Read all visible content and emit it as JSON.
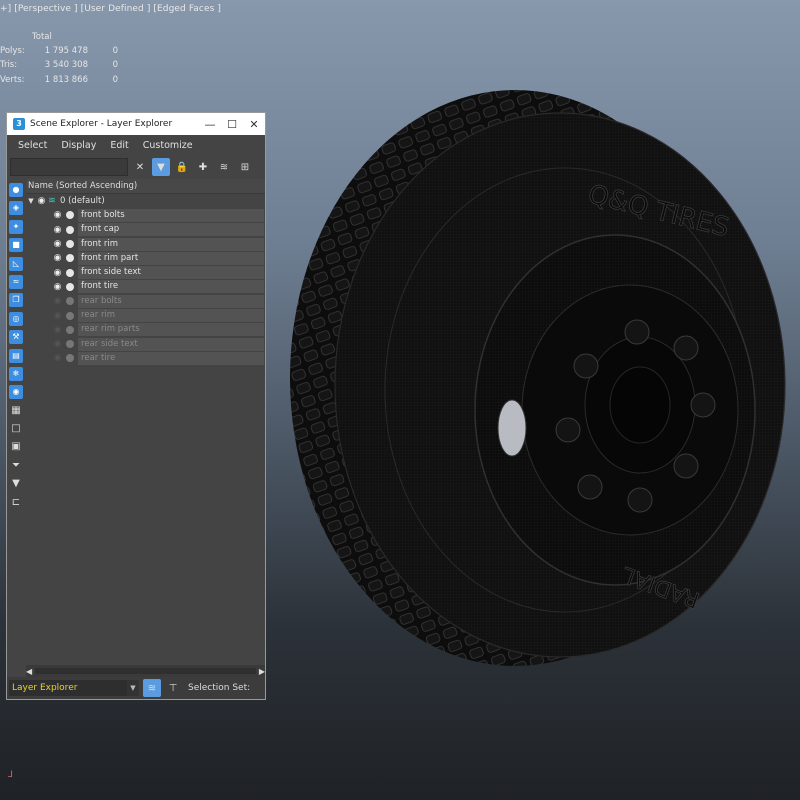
{
  "viewport": {
    "label": "+] [Perspective ] [User Defined ] [Edged Faces ]",
    "stats": {
      "header": "Total",
      "rows": [
        {
          "key": "Polys:",
          "value": "1 795 478",
          "zero": "0"
        },
        {
          "key": "Tris:",
          "value": "3 540 308",
          "zero": "0"
        },
        {
          "key": "Verts:",
          "value": "1 813 866",
          "zero": "0"
        }
      ]
    },
    "tire_text": {
      "brand": "Q&Q TIRES",
      "side": "RADIAL"
    }
  },
  "window": {
    "title": "Scene Explorer - Layer Explorer",
    "app_icon": "3",
    "minimize": "—",
    "maximize": "☐",
    "close": "✕",
    "menu": {
      "select": "Select",
      "display": "Display",
      "edit": "Edit",
      "customize": "Customize"
    },
    "column_header": "Name (Sorted Ascending)",
    "default_layer": "0 (default)",
    "layers": [
      {
        "name": "front bolts",
        "visible": true
      },
      {
        "name": "front cap",
        "visible": true
      },
      {
        "name": "front rim",
        "visible": true
      },
      {
        "name": "front rim part",
        "visible": true
      },
      {
        "name": "front side text",
        "visible": true
      },
      {
        "name": "front tire",
        "visible": true
      },
      {
        "name": "rear bolts",
        "visible": false
      },
      {
        "name": "rear rim",
        "visible": false
      },
      {
        "name": "rear rim parts",
        "visible": false
      },
      {
        "name": "rear side text",
        "visible": false
      },
      {
        "name": "rear tire",
        "visible": false
      }
    ],
    "explorer_combo": "Layer Explorer",
    "selection_set_label": "Selection Set:"
  },
  "colors": {
    "accent": "#5b9be0",
    "combo_text": "#e8d22c",
    "layer_stack": "#3ccfb7"
  }
}
